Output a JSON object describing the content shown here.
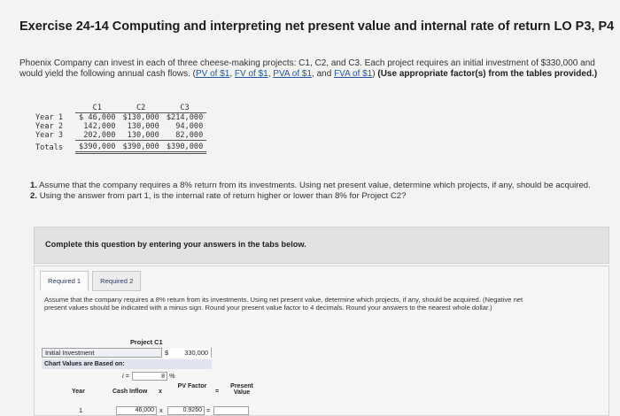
{
  "title": "Exercise 24-14 Computing and interpreting net present value and internal rate of return LO P3, P4",
  "intro": {
    "text1": "Phoenix Company can invest in each of three cheese-making projects: C1, C2, and C3. Each project requires an initial investment of $330,000 and would yield the following annual cash flows. (",
    "links": [
      "PV of $1",
      "FV of $1",
      "PVA of $1",
      "FVA of $1"
    ],
    "bold": "(Use appropriate factor(s) from the tables provided.)"
  },
  "cash_table": {
    "columns": [
      "C1",
      "C2",
      "C3"
    ],
    "rows": [
      {
        "label": "Year 1",
        "values": [
          "$ 46,000",
          "$130,000",
          "$214,000"
        ]
      },
      {
        "label": "Year 2",
        "values": [
          "142,000",
          "130,000",
          "94,000"
        ]
      },
      {
        "label": "Year 3",
        "values": [
          "202,000",
          "130,000",
          "82,000"
        ]
      }
    ],
    "totals": {
      "label": "Totals",
      "values": [
        "$390,000",
        "$390,000",
        "$390,000"
      ]
    }
  },
  "questions": {
    "q1_num": "1.",
    "q1": "Assume that the company requires a 8% return from its investments. Using net present value, determine which projects, if any, should be acquired.",
    "q2_num": "2.",
    "q2": "Using the answer from part 1, is the internal rate of return higher or lower than 8% for Project C2?"
  },
  "complete_box": "Complete this question by entering your answers in the tabs below.",
  "tabs": [
    {
      "label": "Required 1",
      "active": true
    },
    {
      "label": "Required 2",
      "active": false
    }
  ],
  "instructions": "Assume that the company requires a 8% return from its investments. Using net present value, determine which projects, if any, should be acquired. (Negative net present values should be indicated with a minus sign. Round your present value factor to 4 decimals. Round your answers to the nearest whole dollar.)",
  "calc": {
    "project_header": "Project C1",
    "initial_investment_label": "Initial Investment",
    "currency": "$",
    "initial_investment_value": "330,000",
    "chart_values_label": "Chart Values are Based on:",
    "i_label": "i =",
    "rate_value": "8",
    "rate_unit": "%",
    "headers": {
      "year": "Year",
      "cash_inflow": "Cash Inflow",
      "times": "x",
      "pv_factor": "PV Factor",
      "equals": "=",
      "present_value": "Present Value"
    },
    "rows": [
      {
        "year": "1",
        "cash_inflow": "46,000",
        "times": "x",
        "pv_factor": "0.9260",
        "equals": "="
      }
    ]
  }
}
